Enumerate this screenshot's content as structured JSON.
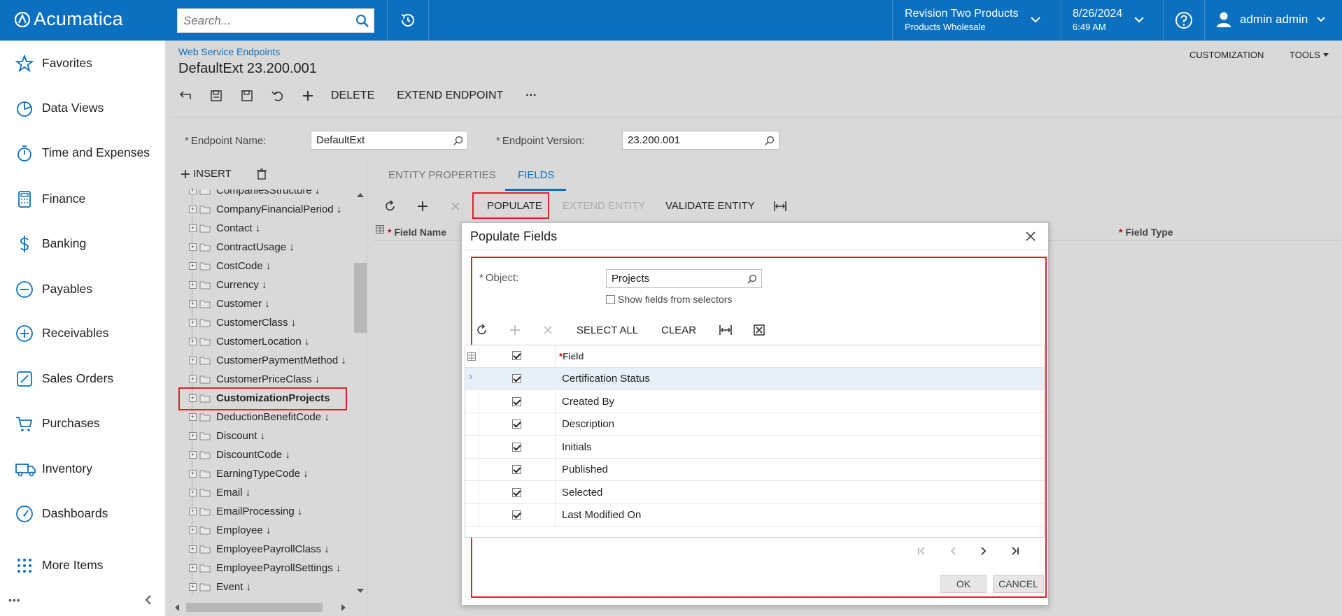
{
  "topbar": {
    "brand": "Acumatica",
    "search_placeholder": "Search...",
    "company_name": "Revision Two Products",
    "company_branch": "Products Wholesale",
    "date": "8/26/2024",
    "time": "6:49 AM",
    "user": "admin admin"
  },
  "nav": {
    "items": [
      {
        "label": "Favorites",
        "icon": "star-icon"
      },
      {
        "label": "Data Views",
        "icon": "pie-chart-icon"
      },
      {
        "label": "Time and Expenses",
        "icon": "stopwatch-icon"
      },
      {
        "label": "Finance",
        "icon": "calculator-icon"
      },
      {
        "label": "Banking",
        "icon": "dollar-icon"
      },
      {
        "label": "Payables",
        "icon": "minus-circle-icon"
      },
      {
        "label": "Receivables",
        "icon": "plus-circle-icon"
      },
      {
        "label": "Sales Orders",
        "icon": "edit-icon"
      },
      {
        "label": "Purchases",
        "icon": "cart-icon"
      },
      {
        "label": "Inventory",
        "icon": "truck-icon"
      },
      {
        "label": "Dashboards",
        "icon": "gauge-icon"
      },
      {
        "label": "More Items",
        "icon": "grid-dots-icon"
      }
    ],
    "more_dots": "•••"
  },
  "page": {
    "breadcrumb": "Web Service Endpoints",
    "title": "DefaultExt 23.200.001",
    "customization": "CUSTOMIZATION",
    "tools": "TOOLS",
    "toolbar": {
      "delete": "DELETE",
      "extend_endpoint": "EXTEND ENDPOINT",
      "more": "···"
    }
  },
  "form": {
    "endpoint_name_label": "Endpoint Name:",
    "endpoint_name_value": "DefaultExt",
    "endpoint_version_label": "Endpoint Version:",
    "endpoint_version_value": "23.200.001",
    "required_mark": "*"
  },
  "tree": {
    "insert_label": "INSERT",
    "items": [
      "CompaniesStructure ↓",
      "CompanyFinancialPeriod ↓",
      "Contact ↓",
      "ContractUsage ↓",
      "CostCode ↓",
      "Currency ↓",
      "Customer ↓",
      "CustomerClass ↓",
      "CustomerLocation ↓",
      "CustomerPaymentMethod ↓",
      "CustomerPriceClass ↓",
      "CustomizationProjects",
      "DeductionBenefitCode ↓",
      "Discount ↓",
      "DiscountCode ↓",
      "EarningTypeCode ↓",
      "Email ↓",
      "EmailProcessing ↓",
      "Employee ↓",
      "EmployeePayrollClass ↓",
      "EmployeePayrollSettings ↓",
      "Event ↓"
    ],
    "selected": "CustomizationProjects"
  },
  "tabs": {
    "entity_properties": "ENTITY PROPERTIES",
    "fields": "FIELDS"
  },
  "grid_toolbar": {
    "populate": "POPULATE",
    "extend_entity": "EXTEND ENTITY",
    "validate_entity": "VALIDATE ENTITY"
  },
  "grid_header": {
    "field_name": "Field Name",
    "field_type": "Field Type",
    "star": "*"
  },
  "modal": {
    "title": "Populate Fields",
    "object_label": "Object:",
    "object_value": "Projects",
    "show_selectors": "Show fields from selectors",
    "select_all": "SELECT ALL",
    "clear": "CLEAR",
    "field_header": "Field",
    "rows": [
      {
        "field": "Certification Status",
        "checked": true
      },
      {
        "field": "Created By",
        "checked": true
      },
      {
        "field": "Description",
        "checked": true
      },
      {
        "field": "Initials",
        "checked": true
      },
      {
        "field": "Published",
        "checked": true
      },
      {
        "field": "Selected",
        "checked": true
      },
      {
        "field": "Last Modified On",
        "checked": true
      }
    ],
    "ok": "OK",
    "cancel": "CANCEL"
  },
  "colors": {
    "brand_blue": "#0a70bf",
    "highlight_red": "#e0212b",
    "panel_gray": "#d9d9d9"
  }
}
